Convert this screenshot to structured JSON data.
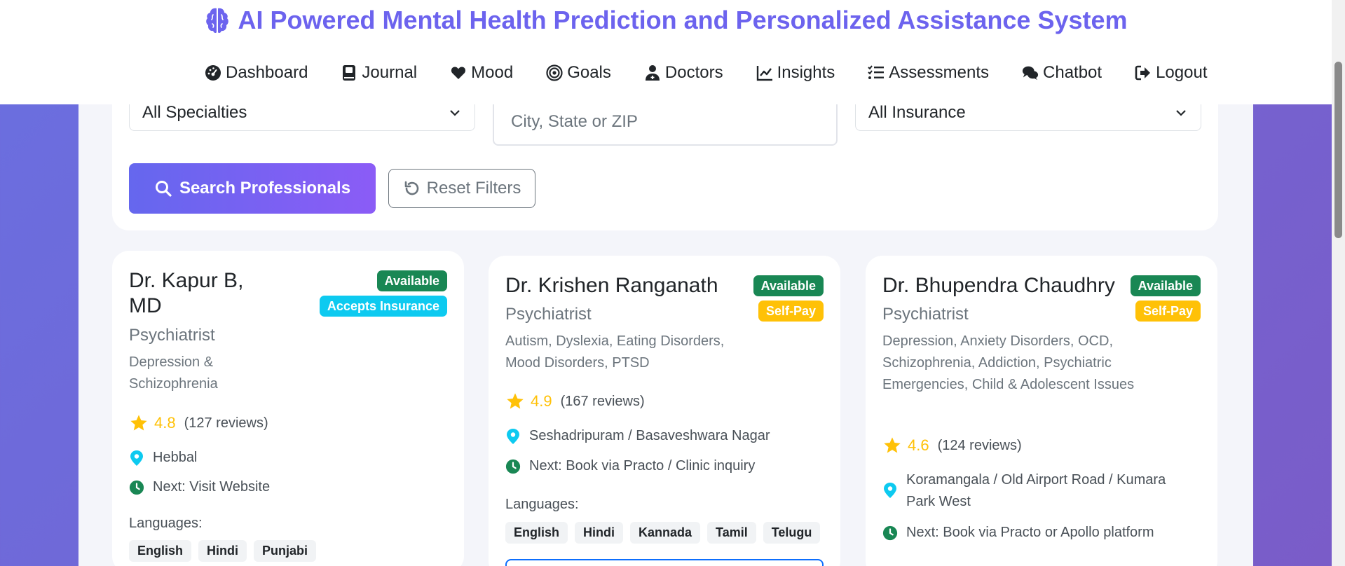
{
  "header": {
    "title": "AI Powered Mental Health Prediction and Personalized Assistance System",
    "nav": [
      {
        "label": "Dashboard",
        "icon": "dashboard-icon"
      },
      {
        "label": "Journal",
        "icon": "journal-icon"
      },
      {
        "label": "Mood",
        "icon": "heart-icon"
      },
      {
        "label": "Goals",
        "icon": "target-icon"
      },
      {
        "label": "Doctors",
        "icon": "doctor-icon"
      },
      {
        "label": "Insights",
        "icon": "chart-line-icon"
      },
      {
        "label": "Assessments",
        "icon": "checklist-icon"
      },
      {
        "label": "Chatbot",
        "icon": "chat-icon"
      },
      {
        "label": "Logout",
        "icon": "logout-icon"
      }
    ]
  },
  "filters": {
    "specialty_selected": "All Specialties",
    "location_placeholder": "City, State or ZIP",
    "insurance_selected": "All Insurance",
    "search_label": "Search Professionals",
    "reset_label": "Reset Filters"
  },
  "doctors": [
    {
      "name_line1": "Dr. Kapur B,",
      "name_line2": "MD",
      "availability": "Available",
      "payment": "Accepts Insurance",
      "title": "Psychiatrist",
      "specialties": "Depression & Schizophrenia",
      "rating": "4.8",
      "reviews": "(127 reviews)",
      "location": "Hebbal",
      "next": "Next: Visit Website",
      "languages_label": "Languages:",
      "languages": [
        "English",
        "Hindi",
        "Punjabi"
      ]
    },
    {
      "name_line1": "Dr. Krishen Ranganath",
      "availability": "Available",
      "payment": "Self-Pay",
      "title": "Psychiatrist",
      "specialties": "Autism, Dyslexia, Eating Disorders, Mood Disorders, PTSD",
      "rating": "4.9",
      "reviews": "(167 reviews)",
      "location": "Seshadripuram / Basaveshwara Nagar",
      "next": "Next: Book via Practo / Clinic inquiry",
      "languages_label": "Languages:",
      "languages": [
        "English",
        "Hindi",
        "Kannada",
        "Tamil",
        "Telugu"
      ]
    },
    {
      "name_line1": "Dr. Bhupendra Chaudhry",
      "availability": "Available",
      "payment": "Self-Pay",
      "title": "Psychiatrist",
      "specialties": "Depression, Anxiety Disorders, OCD, Schizophrenia, Addiction, Psychiatric Emergencies, Child & Adolescent Issues",
      "rating": "4.6",
      "reviews": "(124 reviews)",
      "location": "Koramangala / Old Airport Road / Kumara Park West",
      "next": "Next: Book via Practo or Apollo platform"
    }
  ],
  "colors": {
    "brand": "#6c63ee",
    "available": "#198754",
    "insurance": "#0dcaf0",
    "self_pay": "#ffc107",
    "location_pin": "#0dcaf0",
    "clock": "#198754"
  }
}
